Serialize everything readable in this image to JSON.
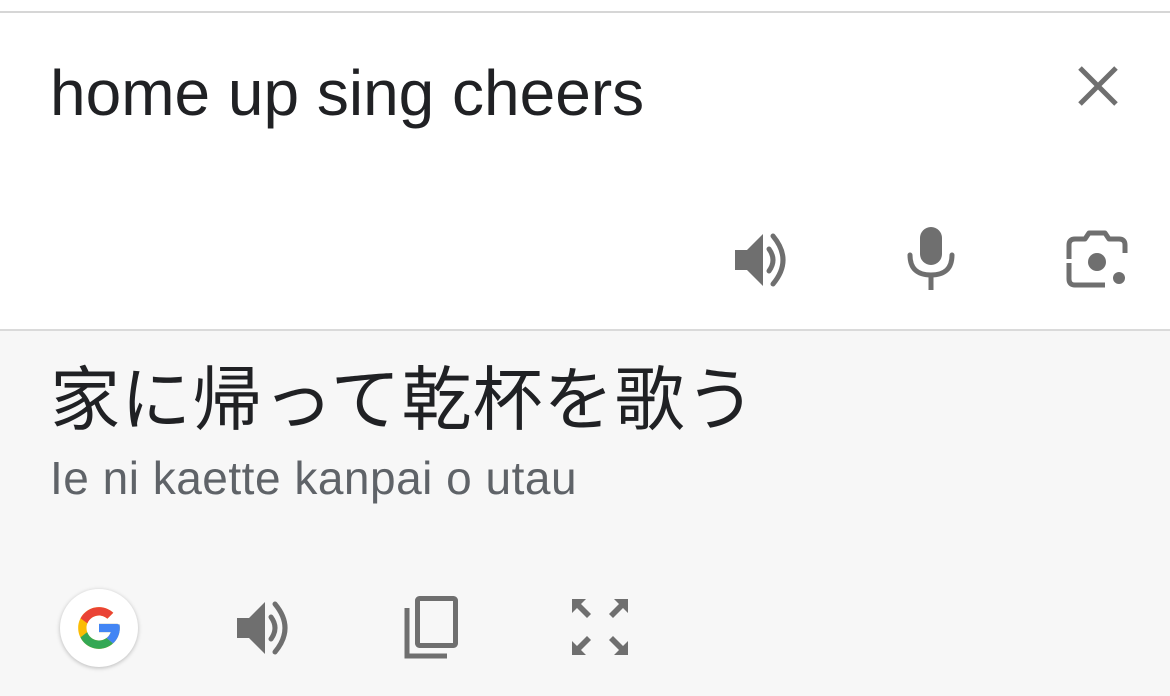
{
  "source": {
    "text": "home up sing cheers",
    "clear_icon": "close-icon",
    "tools": [
      {
        "name": "listen-source-button",
        "icon": "speaker-icon"
      },
      {
        "name": "voice-input-button",
        "icon": "microphone-icon"
      },
      {
        "name": "camera-translate-button",
        "icon": "camera-icon"
      }
    ]
  },
  "result": {
    "translation": "家に帰って乾杯を歌う",
    "romanization": "Ie ni kaette kanpai o utau",
    "tools": [
      {
        "name": "google-logo",
        "icon": "google-g-icon"
      },
      {
        "name": "listen-translation-button",
        "icon": "speaker-icon"
      },
      {
        "name": "copy-button",
        "icon": "copy-icon"
      },
      {
        "name": "fullscreen-button",
        "icon": "expand-icon"
      }
    ]
  },
  "colors": {
    "icon": "#6f6f6f",
    "text_primary": "#202124",
    "text_secondary": "#5f6368",
    "result_bg": "#f7f7f7",
    "google_blue": "#4285F4",
    "google_red": "#EA4335",
    "google_yellow": "#FBBC05",
    "google_green": "#34A853"
  }
}
